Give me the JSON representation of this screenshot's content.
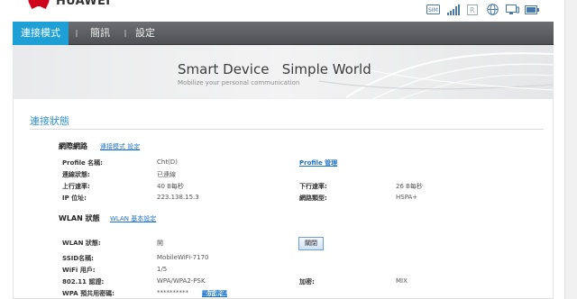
{
  "brand": {
    "name": "HUAWEI"
  },
  "status_icons": [
    "sim-icon",
    "signal-icon",
    "roaming-icon",
    "globe-icon",
    "device-icon",
    "battery-icon"
  ],
  "nav": {
    "tabs": [
      {
        "label": "連接模式"
      },
      {
        "label": "簡訊"
      },
      {
        "label": "設定"
      }
    ]
  },
  "banner": {
    "title": "Smart Device   Simple World",
    "subtitle": "Mobilize your personal communication"
  },
  "page": {
    "title": "連接狀態"
  },
  "network": {
    "heading": "網際網路",
    "link": "連接模式 設定",
    "rows": [
      {
        "label": "Profile 名稱:",
        "value": "Cht(D)"
      },
      {
        "label": "連線狀態:",
        "value": "已連線"
      },
      {
        "label": "上行速率:",
        "value": "40 B每秒"
      },
      {
        "label": "IP 位址:",
        "value": "223.138.15.3"
      }
    ],
    "right": {
      "profile_link": "Profile 管理",
      "down_label": "下行速率:",
      "down_value": "26 B每秒",
      "type_label": "網路類型:",
      "type_value": "HSPA+"
    }
  },
  "wlan": {
    "heading": "WLAN 狀態",
    "link": "WLAN 基本設定",
    "status_label": "WLAN 狀態:",
    "status_value": "開",
    "close_button": "關閉",
    "rows": [
      {
        "label": "SSID名稱:",
        "value": "MobileWiFi-7170"
      },
      {
        "label": "WiFi 用戶:",
        "value": "1/5"
      },
      {
        "label": "802.11 認證:",
        "value": "WPA/WPA2-PSK"
      },
      {
        "label": "WPA 預共用密碼:",
        "value": "**********"
      }
    ],
    "encrypt_label": "加密:",
    "encrypt_value": "MIX",
    "show_password_link": "顯示密碼"
  }
}
